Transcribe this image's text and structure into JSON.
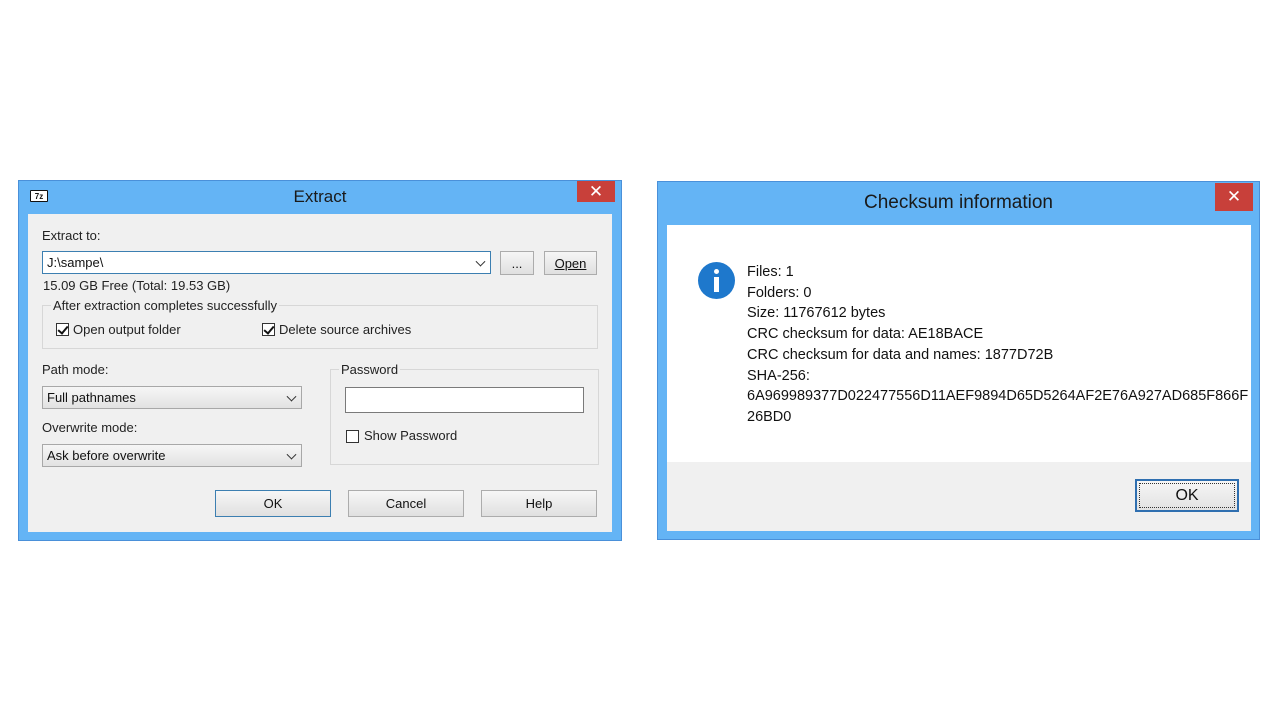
{
  "extract": {
    "title": "Extract",
    "app_icon_text": "7z",
    "close_glyph": "✕",
    "extract_to_label": "Extract to:",
    "path_value": "J:\\sampe\\",
    "browse_label": "...",
    "open_label": "Open",
    "free_space": "15.09 GB Free (Total: 19.53 GB)",
    "after_group_label": "After extraction completes successfully",
    "open_output_folder": {
      "label": "Open output folder",
      "checked": true
    },
    "delete_source": {
      "label": "Delete source archives",
      "checked": true
    },
    "path_mode_label": "Path mode:",
    "path_mode_value": "Full pathnames",
    "overwrite_mode_label": "Overwrite mode:",
    "overwrite_mode_value": "Ask before overwrite",
    "password_group_label": "Password",
    "password_value": "",
    "show_password": {
      "label": "Show Password",
      "checked": false
    },
    "ok_label": "OK",
    "cancel_label": "Cancel",
    "help_label": "Help"
  },
  "checksum": {
    "title": "Checksum information",
    "close_glyph": "✕",
    "lines": [
      "Files: 1",
      "Folders: 0",
      "Size: 11767612 bytes",
      "CRC checksum for data: AE18BACE",
      "CRC checksum for data and names: 1877D72B",
      "SHA-256:",
      "6A969989377D022477556D11AEF9894D65D5264AF2E76A927AD685F866F",
      "26BD0"
    ],
    "ok_label": "OK"
  },
  "colors": {
    "title_bar": "#64b4f5",
    "close_button": "#c8403a",
    "dialog_body": "#f0f0f0",
    "info_icon": "#1e78cc"
  }
}
